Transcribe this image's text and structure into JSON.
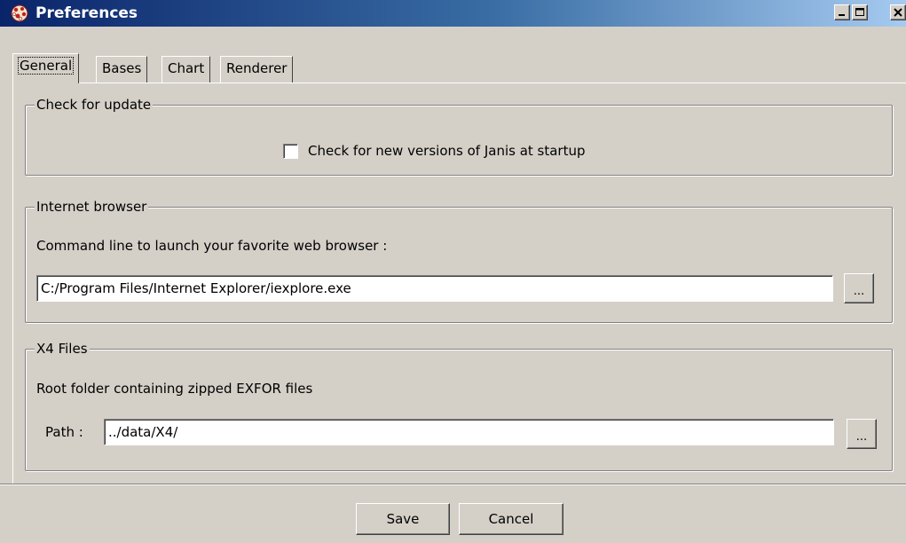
{
  "window": {
    "title": "Preferences",
    "icon": "janis-app-icon",
    "controls": [
      "minimize-icon",
      "maximize-icon",
      "close-icon"
    ]
  },
  "tabs": [
    {
      "label": "General",
      "active": true
    },
    {
      "label": "Bases",
      "active": false
    },
    {
      "label": "Chart",
      "active": false
    },
    {
      "label": "Renderer",
      "active": false
    }
  ],
  "update_group": {
    "title": "Check for update",
    "checkbox_label": "Check for new versions of Janis at startup",
    "checked": false
  },
  "browser_group": {
    "title": "Internet browser",
    "description": "Command line to launch your favorite web browser :",
    "command_value": "C:/Program Files/Internet Explorer/iexplore.exe",
    "browse_label": "..."
  },
  "x4_group": {
    "title": "X4 Files",
    "description": "Root folder containing zipped EXFOR files",
    "path_label": "Path :",
    "path_value": "../data/X4/",
    "browse_label": "..."
  },
  "footer": {
    "save_label": "Save",
    "cancel_label": "Cancel"
  }
}
